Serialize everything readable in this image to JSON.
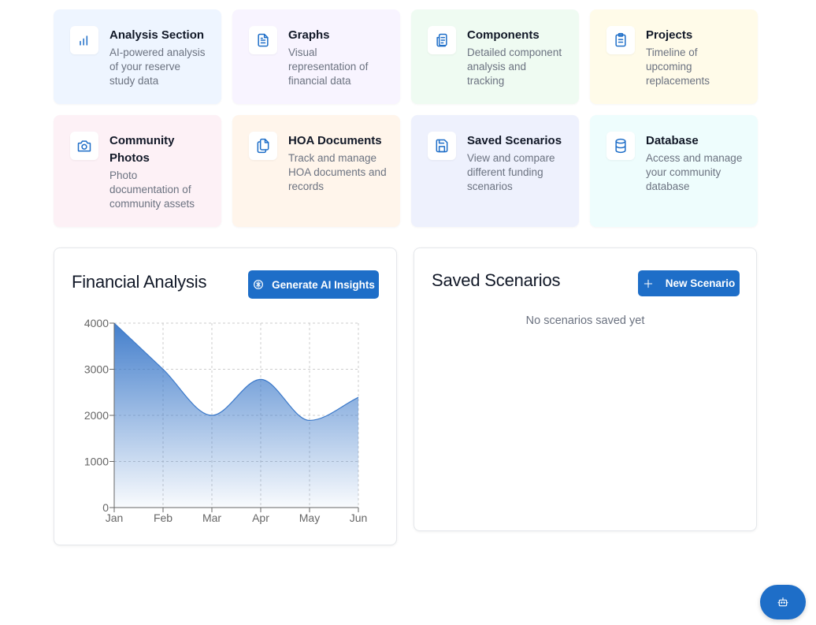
{
  "cards": [
    {
      "title": "Analysis Section",
      "desc": "AI-powered analysis of your reserve study data",
      "icon": "bar-chart-icon",
      "bg": "#eef5ff"
    },
    {
      "title": "Graphs",
      "desc": "Visual representation of financial data",
      "icon": "document-icon",
      "bg": "#f8f4ff"
    },
    {
      "title": "Components",
      "desc": "Detailed component analysis and tracking",
      "icon": "components-icon",
      "bg": "#effbf2"
    },
    {
      "title": "Projects",
      "desc": "Timeline of upcoming replacements",
      "icon": "clipboard-icon",
      "bg": "#fffbe9"
    },
    {
      "title": "Community Photos",
      "desc": "Photo documentation of community assets",
      "icon": "camera-icon",
      "bg": "#fdf1f6"
    },
    {
      "title": "HOA Documents",
      "desc": "Track and manage HOA documents and records",
      "icon": "files-icon",
      "bg": "#fff5eb"
    },
    {
      "title": "Saved Scenarios",
      "desc": "View and compare different funding scenarios",
      "icon": "save-icon",
      "bg": "#eef1fd"
    },
    {
      "title": "Database",
      "desc": "Access and manage your community database",
      "icon": "database-icon",
      "bg": "#eefdfd"
    }
  ],
  "financial": {
    "title": "Financial Analysis",
    "button_label": "Generate AI Insights",
    "button_icon": "ai-chip-icon"
  },
  "scenarios": {
    "title": "Saved Scenarios",
    "button_label": "New Scenario",
    "button_icon": "plus-icon",
    "empty_text": "No scenarios saved yet"
  },
  "chat_button": {
    "icon": "robot-icon"
  },
  "colors": {
    "accent": "#1e6ec8",
    "line": "#3a78c9"
  },
  "chart_data": {
    "type": "area",
    "categories": [
      "Jan",
      "Feb",
      "Mar",
      "Apr",
      "May",
      "Jun"
    ],
    "values": [
      4000,
      3000,
      2000,
      2780,
      1890,
      2390
    ],
    "yticks": [
      0,
      1000,
      2000,
      3000,
      4000
    ],
    "ylim": [
      0,
      4000
    ],
    "grid": true,
    "title": "",
    "xlabel": "",
    "ylabel": ""
  }
}
